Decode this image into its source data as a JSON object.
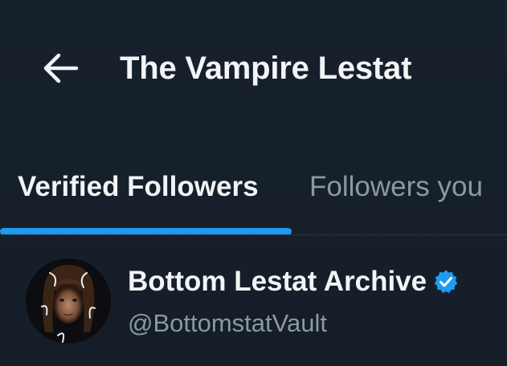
{
  "header": {
    "back_icon": "arrow-left-icon",
    "title": "The Vampire Lestat"
  },
  "tabs": [
    {
      "label": "Verified Followers",
      "active": true
    },
    {
      "label": "Followers you",
      "active": false
    }
  ],
  "colors": {
    "background": "#15202b",
    "accent": "#1d9bf0",
    "primary_text": "#f2f4f5",
    "secondary_text": "#8b98a5"
  },
  "users": [
    {
      "display_name": "Bottom Lestat Archive",
      "handle": "@BottomstatVault",
      "verified": true,
      "verified_icon": "verified-badge-icon",
      "avatar_icon": "avatar-portrait"
    }
  ]
}
